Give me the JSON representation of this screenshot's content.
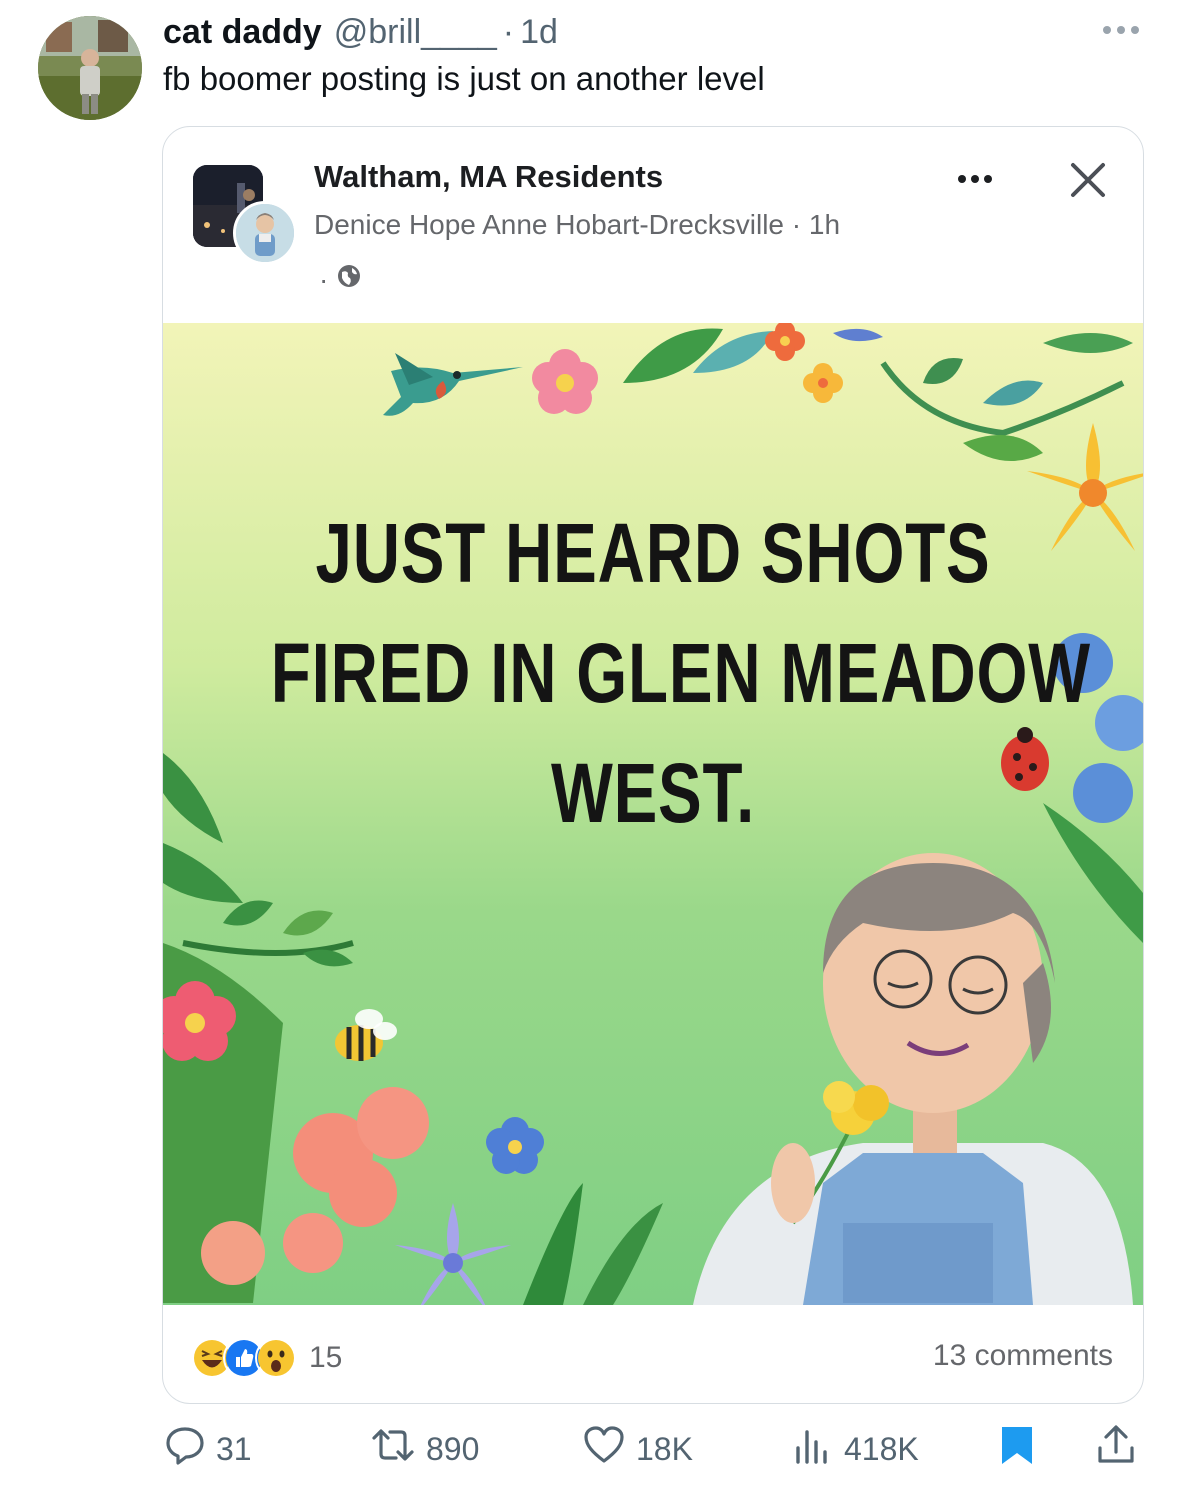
{
  "tweet": {
    "author_name": "cat daddy",
    "handle": "@brill____",
    "separator": "·",
    "time": "1d",
    "text": "fb boomer posting is just on another level"
  },
  "fb_post": {
    "group_name": "Waltham, MA Residents",
    "poster_line": "Denice Hope Anne Hobart-Drecksville · 1h",
    "privacy_dot": "·",
    "privacy_icon": "globe-icon",
    "image_lines": [
      "JUST HEARD SHOTS",
      "FIRED IN GLEN MEADOW",
      "WEST."
    ],
    "reactions": [
      "laughing-emoji",
      "like-emoji",
      "wow-emoji"
    ],
    "reaction_count": "15",
    "comments_label": "13 comments"
  },
  "actions": {
    "replies": "31",
    "retweets": "890",
    "likes": "18K",
    "views": "418K"
  },
  "colors": {
    "text_primary": "#0f1419",
    "text_secondary": "#536471",
    "bookmark_active": "#1d9bf0",
    "fb_secondary": "#65676b"
  }
}
